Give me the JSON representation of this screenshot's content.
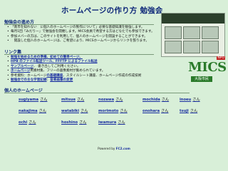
{
  "header": {
    "title": "ホームページの作り方 勉強会"
  },
  "sections": {
    "aim": {
      "heading": "勉強会の進め方",
      "bullets": [
        "「南市を知れない　に個人のホームページの製作について」必要な基礎知識を勉強します。",
        "毎月1回「みだりー」で勉強会を開催します。MICS会員で希望する方はどなたでも参加できます。",
        "参加メバーの方は、このサイトを利用して、個人のホームページを開設することができます。",
        "　開設した個人のホームページは、ご希望により、MICSホームページからリンクを張ります。"
      ]
    },
    "links": {
      "heading": "リンク集",
      "items": [
        {
          "text": "勉強を始めるための準備、初めての簡単ページ、",
          "link": true
        },
        {
          "text": "HPB のファイル転送ツール、FFFTP によるファイル転送",
          "link": true
        },
        {
          "text": "サンプルページ",
          "link": true,
          "after": "、 書き出してご利用ください。"
        },
        {
          "text": "ホームページ",
          "link": true,
          "after": "用素材集、フリーの画像素材が集められています。"
        },
        {
          "text": "参考資料：ホームページ",
          "link": false,
          "linkpart": "の基礎講座",
          "after": "、スタイルシート講座、ホームページ作成の作成技術"
        },
        {
          "text": "勉強会での主な学習記録",
          "link": true,
          "sep": "：",
          "extra": "音楽画像の変更",
          "extralink": true
        }
      ]
    },
    "members": {
      "heading": "個人のホームページ",
      "suffix": "さん",
      "list": [
        "sugiyama",
        "mitsue",
        "nozawa",
        "mochida",
        "inoeu",
        "nakajima",
        "watabiki",
        "morimoto",
        "onohara",
        "tsuji",
        "ochi",
        "hoshino",
        "iwamura"
      ]
    }
  },
  "badge": {
    "brand": "MICS",
    "tag": "NPO",
    "sub": "大阪市民"
  },
  "footer": {
    "prefix": "Powered by ",
    "brand": "FC2.com"
  },
  "colors": {
    "background": "#d8efd8",
    "heading": "#102a7a",
    "link": "#1a2fa0",
    "brand": "#2a7a2a"
  }
}
